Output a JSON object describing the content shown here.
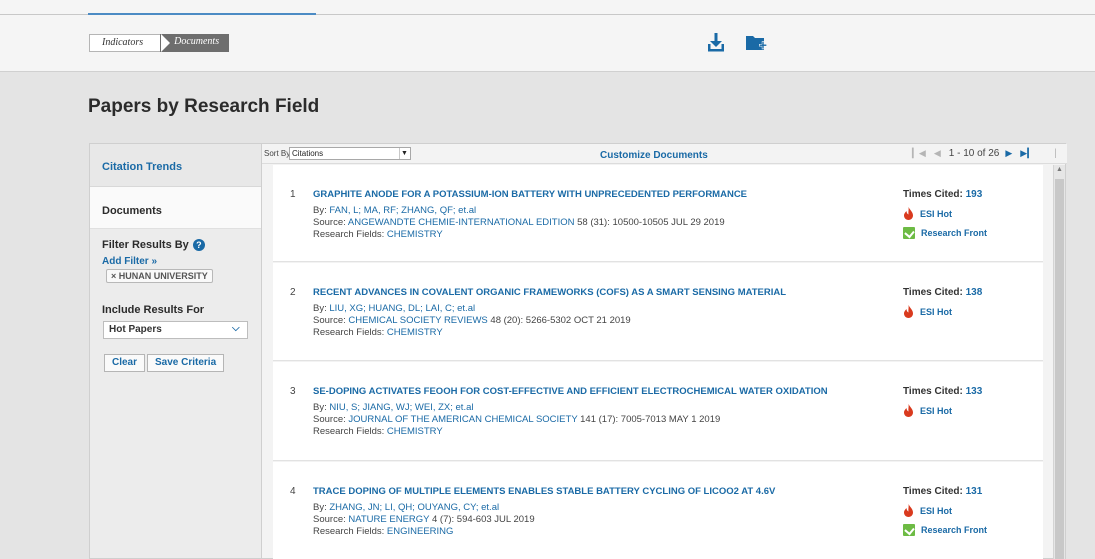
{
  "breadcrumb": {
    "items": [
      "Indicators",
      "Documents"
    ]
  },
  "toolbar": {
    "download_icon": "download-icon",
    "add_folder_icon": "folder-add-icon"
  },
  "page_title": "Papers by Research Field",
  "sidebar": {
    "tab_citation_trends": "Citation Trends",
    "tab_documents": "Documents",
    "filter_title": "Filter Results By",
    "add_filter": "Add Filter »",
    "filter_chip": "HUNAN UNIVERSITY",
    "filter_chip_remove": "×",
    "include_title": "Include Results For",
    "include_value": "Hot Papers",
    "clear_label": "Clear",
    "save_label": "Save Criteria"
  },
  "main": {
    "sort_label": "Sort By",
    "sort_value": "Citations",
    "customize": "Customize Documents",
    "pager_text": "1 - 10 of 26"
  },
  "records": [
    {
      "num": "1",
      "title": "GRAPHITE ANODE FOR A POTASSIUM-ION BATTERY WITH UNPRECEDENTED PERFORMANCE",
      "by_label": "By:",
      "authors": "FAN, L;  MA, RF;  ZHANG, QF;  et.al",
      "source_label": "Source:",
      "source_name": "ANGEWANDTE CHEMIE-INTERNATIONAL EDITION",
      "source_rest": "58 (31): 10500-10505 JUL 29 2019",
      "fields_label": "Research Fields:",
      "field": "CHEMISTRY",
      "cited_label": "Times Cited:",
      "cited": "193",
      "esi_hot": "ESI Hot",
      "research_front": "Research Front"
    },
    {
      "num": "2",
      "title": "RECENT ADVANCES IN COVALENT ORGANIC FRAMEWORKS (COFS) AS A SMART SENSING MATERIAL",
      "by_label": "By:",
      "authors": "LIU, XG;  HUANG, DL;  LAI, C;  et.al",
      "source_label": "Source:",
      "source_name": "CHEMICAL SOCIETY REVIEWS",
      "source_rest": "48 (20): 5266-5302 OCT 21 2019",
      "fields_label": "Research Fields:",
      "field": "CHEMISTRY",
      "cited_label": "Times Cited:",
      "cited": "138",
      "esi_hot": "ESI Hot"
    },
    {
      "num": "3",
      "title": "SE-DOPING ACTIVATES FEOOH FOR COST-EFFECTIVE AND EFFICIENT ELECTROCHEMICAL WATER OXIDATION",
      "by_label": "By:",
      "authors": "NIU, S;  JIANG, WJ;  WEI, ZX;  et.al",
      "source_label": "Source:",
      "source_name": "JOURNAL OF THE AMERICAN CHEMICAL SOCIETY",
      "source_rest": "141 (17): 7005-7013 MAY 1 2019",
      "fields_label": "Research Fields:",
      "field": "CHEMISTRY",
      "cited_label": "Times Cited:",
      "cited": "133",
      "esi_hot": "ESI Hot"
    },
    {
      "num": "4",
      "title": "TRACE DOPING OF MULTIPLE ELEMENTS ENABLES STABLE BATTERY CYCLING OF LICOO2 AT 4.6V",
      "by_label": "By:",
      "authors": "ZHANG, JN;  LI, QH;  OUYANG, CY;  et.al",
      "source_label": "Source:",
      "source_name": "NATURE ENERGY",
      "source_rest": "4 (7): 594-603 JUL 2019",
      "fields_label": "Research Fields:",
      "field": "ENGINEERING",
      "cited_label": "Times Cited:",
      "cited": "131",
      "esi_hot": "ESI Hot",
      "research_front": "Research Front"
    }
  ],
  "colors": {
    "link": "#1a6aa6",
    "fire": "#d93a1e",
    "research_front": "#6dbb44"
  }
}
